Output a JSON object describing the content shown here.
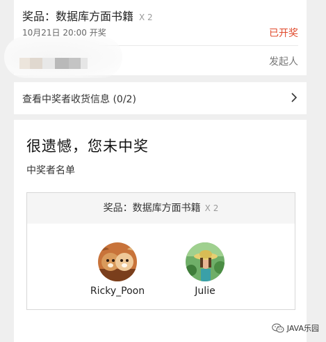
{
  "lottery": {
    "prize_label": "奖品：数据库方面书籍",
    "prize_qty": "X 2",
    "draw_time": "10月21日 20:00 开奖",
    "status": "已开奖",
    "sponsor_label": "发起人"
  },
  "shipping": {
    "link_text": "查看中奖者收货信息 (0/2)"
  },
  "result": {
    "title": "很遗憾，您未中奖",
    "winners_label": "中奖者名单",
    "box_prize_label": "奖品：数据库方面书籍",
    "box_prize_qty": "X 2",
    "winners": [
      {
        "name": "Ricky_Poon",
        "avatar_icon": "dog-photo-avatar"
      },
      {
        "name": "Julie",
        "avatar_icon": "person-in-hat-avatar"
      }
    ]
  },
  "watermark": {
    "text": "JAVA乐园",
    "icon": "wechat-icon"
  },
  "colors": {
    "status": "#e0492b",
    "page_bg": "#efefef",
    "header_bg": "#f5f5f5"
  }
}
